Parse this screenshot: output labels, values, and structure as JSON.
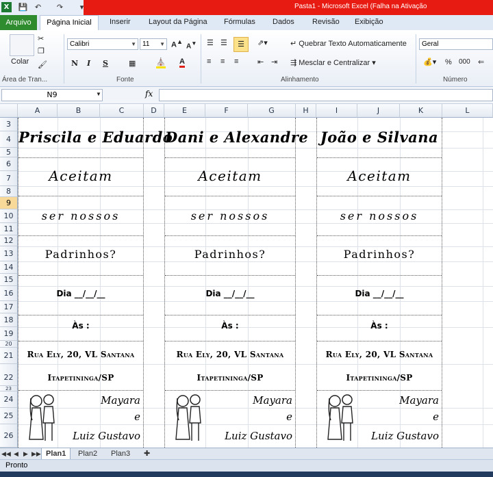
{
  "window": {
    "title": "Pasta1  -  Microsoft Excel (Falha na Ativação"
  },
  "ribbon_tabs": [
    "Arquivo",
    "Página Inicial",
    "Inserir",
    "Layout da Página",
    "Fórmulas",
    "Dados",
    "Revisão",
    "Exibição"
  ],
  "ribbon": {
    "paste_label": "Colar",
    "font_name": "Calibri",
    "font_size": "11",
    "bold": "N",
    "italic": "I",
    "underline": "S",
    "wrap_text": "Quebrar Texto Automaticamente",
    "merge_center": "Mesclar e Centralizar",
    "number_format": "Geral",
    "percent": "%",
    "thousands": "000",
    "groups": {
      "clipboard": "Área de Tran...",
      "font": "Fonte",
      "alignment": "Alinhamento",
      "number": "Número"
    }
  },
  "formula_bar": {
    "name_box": "N9",
    "fx": "fx",
    "value": ""
  },
  "columns": [
    "A",
    "B",
    "C",
    "D",
    "E",
    "F",
    "G",
    "H",
    "I",
    "J",
    "K",
    "L"
  ],
  "rows": [
    "3",
    "4",
    "5",
    "6",
    "7",
    "8",
    "9",
    "10",
    "11",
    "12",
    "13",
    "14",
    "15",
    "16",
    "17",
    "18",
    "19",
    "20",
    "21",
    "22",
    "23",
    "24",
    "25",
    "26"
  ],
  "selected_row": "9",
  "cards": [
    {
      "names": "Priscila e Eduardo",
      "line1": "Aceitam",
      "line2": "ser nossos",
      "line3": "Padrinhos?",
      "date": "Dia __/__/__",
      "time": "Às   :",
      "address": "Rua Ely, 20, VL Santana",
      "city": "Itapetininga/SP",
      "sign1": "Mayara",
      "sign_and": "e",
      "sign2": "Luiz Gustavo"
    },
    {
      "names": "Dani e Alexandre",
      "line1": "Aceitam",
      "line2": "ser nossos",
      "line3": "Padrinhos?",
      "date": "Dia __/__/__",
      "time": "Às   :",
      "address": "Rua Ely, 20, VL Santana",
      "city": "Itapetininga/SP",
      "sign1": "Mayara",
      "sign_and": "e",
      "sign2": "Luiz Gustavo"
    },
    {
      "names": "João e Silvana",
      "line1": "Aceitam",
      "line2": "ser nossos",
      "line3": "Padrinhos?",
      "date": "Dia __/__/__",
      "time": "Às   :",
      "address": "Rua Ely, 20, VL Santana",
      "city": "Itapetininga/SP",
      "sign1": "Mayara",
      "sign_and": "e",
      "sign2": "Luiz Gustavo"
    }
  ],
  "sheets": [
    "Plan1",
    "Plan2",
    "Plan3"
  ],
  "status": "Pronto"
}
